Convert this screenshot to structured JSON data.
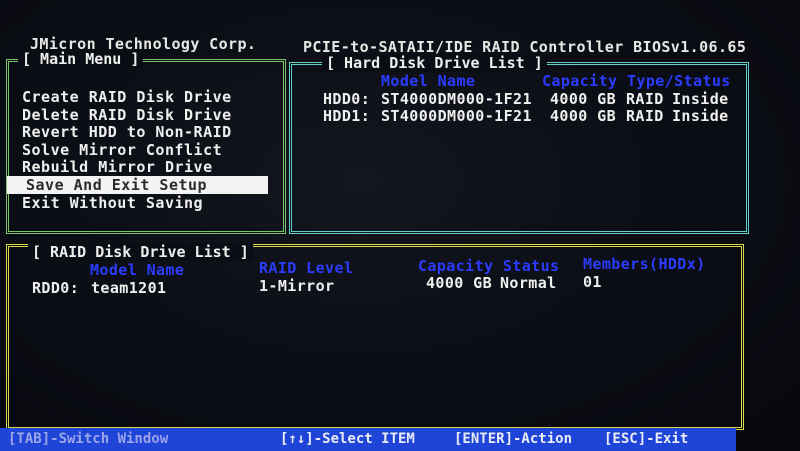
{
  "header": {
    "vendor": "JMicron Technology Corp.",
    "product": "PCIE-to-SATAII/IDE RAID Controller BIOSv1.06.65"
  },
  "main_menu": {
    "title": "[ Main Menu ]",
    "items": [
      {
        "label": "Create RAID Disk Drive"
      },
      {
        "label": "Delete RAID Disk Drive"
      },
      {
        "label": "Revert HDD to Non-RAID"
      },
      {
        "label": "Solve Mirror Conflict"
      },
      {
        "label": "Rebuild Mirror Drive"
      },
      {
        "label": "Save And Exit Setup"
      },
      {
        "label": "Exit Without Saving"
      }
    ],
    "selected_index": 5
  },
  "hdd_list": {
    "title": "[ Hard Disk Drive List ]",
    "columns": {
      "model": "Model Name",
      "capacity": "Capacity",
      "type_status": "Type/Status"
    },
    "rows": [
      {
        "id": "HDD0:",
        "model": "ST4000DM000-1F21",
        "capacity": "4000 GB",
        "type": "RAID",
        "status": "Inside"
      },
      {
        "id": "HDD1:",
        "model": "ST4000DM000-1F21",
        "capacity": "4000 GB",
        "type": "RAID",
        "status": "Inside"
      }
    ]
  },
  "raid_list": {
    "title": "[ RAID Disk Drive List ]",
    "columns": {
      "model": "Model Name",
      "level": "RAID Level",
      "capacity_status": "Capacity Status",
      "members": "Members(HDDx)"
    },
    "rows": [
      {
        "id": "RDD0:",
        "model": "team1201",
        "level": "1-Mirror",
        "capacity": "4000 GB",
        "status": "Normal",
        "members": "01"
      }
    ]
  },
  "status_bar": {
    "switch": "[TAB]-Switch Window",
    "select": "[↑↓]-Select ITEM",
    "action": "[ENTER]-Action",
    "exit": "[ESC]-Exit"
  },
  "colors": {
    "menu_border": "#7cc36e",
    "hdd_border": "#5fd3c9",
    "raid_border": "#d9d94a",
    "column_header": "#2b3cff",
    "status_bar": "#1f44d8",
    "selection_bg": "#f3f3f3"
  }
}
